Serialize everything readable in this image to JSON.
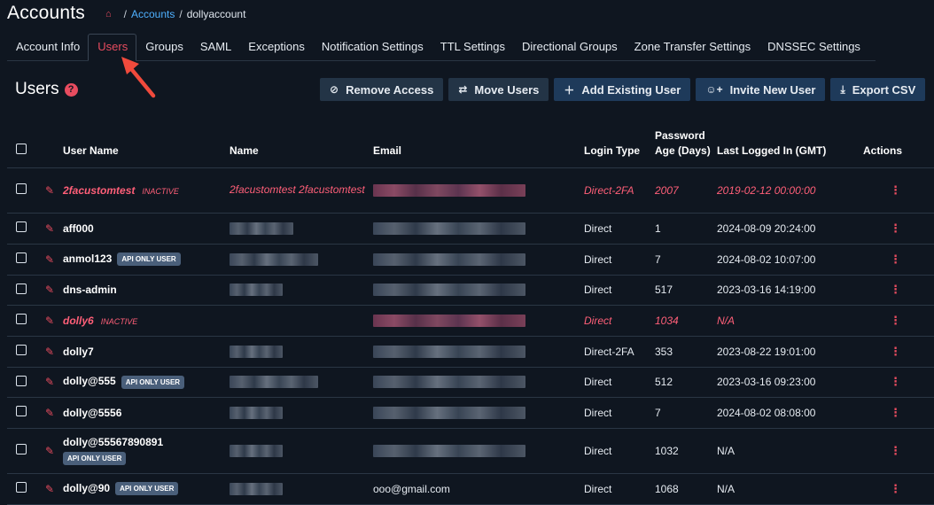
{
  "app_title": "Accounts",
  "breadcrumb": {
    "home_icon": "home-icon",
    "accounts_link": "Accounts",
    "current": "dollyaccount"
  },
  "tabs": [
    "Account Info",
    "Users",
    "Groups",
    "SAML",
    "Exceptions",
    "Notification Settings",
    "TTL Settings",
    "Directional Groups",
    "Zone Transfer Settings",
    "DNSSEC Settings"
  ],
  "active_tab": "Users",
  "section": {
    "title": "Users",
    "help_icon": "?"
  },
  "actions": {
    "remove_access": "Remove Access",
    "move_users": "Move Users",
    "add_existing_user": "Add Existing User",
    "invite_new_user": "Invite New User",
    "export_csv": "Export CSV"
  },
  "table": {
    "headers": {
      "user_name": "User Name",
      "name": "Name",
      "email": "Email",
      "login_type": "Login Type",
      "password_age": "Password Age (Days)",
      "last_logged_in": "Last Logged In (GMT)",
      "actions": "Actions"
    },
    "badges": {
      "inactive": "INACTIVE",
      "api_only": "API ONLY USER"
    },
    "rows": [
      {
        "user_name": "2facustomtest",
        "name": "2facustomtest 2facustomtest",
        "email": "",
        "login_type": "Direct-2FA",
        "password_age": "2007",
        "last_logged_in": "2019-02-12 00:00:00",
        "inactive": true,
        "api_only": false
      },
      {
        "user_name": "aff000",
        "name": "",
        "email": "",
        "login_type": "Direct",
        "password_age": "1",
        "last_logged_in": "2024-08-09 20:24:00",
        "inactive": false,
        "api_only": false
      },
      {
        "user_name": "anmol123",
        "name": "",
        "email": "",
        "login_type": "Direct",
        "password_age": "7",
        "last_logged_in": "2024-08-02 10:07:00",
        "inactive": false,
        "api_only": true
      },
      {
        "user_name": "dns-admin",
        "name": "",
        "email": "",
        "login_type": "Direct",
        "password_age": "517",
        "last_logged_in": "2023-03-16 14:19:00",
        "inactive": false,
        "api_only": false
      },
      {
        "user_name": "dolly6",
        "name": "",
        "email": "",
        "login_type": "Direct",
        "password_age": "1034",
        "last_logged_in": "N/A",
        "inactive": true,
        "api_only": false
      },
      {
        "user_name": "dolly7",
        "name": "",
        "email": "",
        "login_type": "Direct-2FA",
        "password_age": "353",
        "last_logged_in": "2023-08-22 19:01:00",
        "inactive": false,
        "api_only": false
      },
      {
        "user_name": "dolly@555",
        "name": "",
        "email": "",
        "login_type": "Direct",
        "password_age": "512",
        "last_logged_in": "2023-03-16 09:23:00",
        "inactive": false,
        "api_only": true
      },
      {
        "user_name": "dolly@5556",
        "name": "",
        "email": "",
        "login_type": "Direct",
        "password_age": "7",
        "last_logged_in": "2024-08-02 08:08:00",
        "inactive": false,
        "api_only": false
      },
      {
        "user_name": "dolly@55567890891",
        "name": "",
        "email": "",
        "login_type": "Direct",
        "password_age": "1032",
        "last_logged_in": "N/A",
        "inactive": false,
        "api_only": true
      },
      {
        "user_name": "dolly@90",
        "name": "",
        "email": "ooo@gmail.com",
        "login_type": "Direct",
        "password_age": "1068",
        "last_logged_in": "N/A",
        "inactive": false,
        "api_only": true
      }
    ]
  },
  "colors": {
    "background": "#0f1620",
    "accent": "#e84c5f",
    "button": "#1e3a5a",
    "inactive_text": "#ff5f78",
    "link": "#4fb1ff"
  },
  "icons": {
    "row_edit": "pencil-icon",
    "row_actions": "kebab-menu-icon",
    "annotation": "red-arrow-pointer"
  }
}
